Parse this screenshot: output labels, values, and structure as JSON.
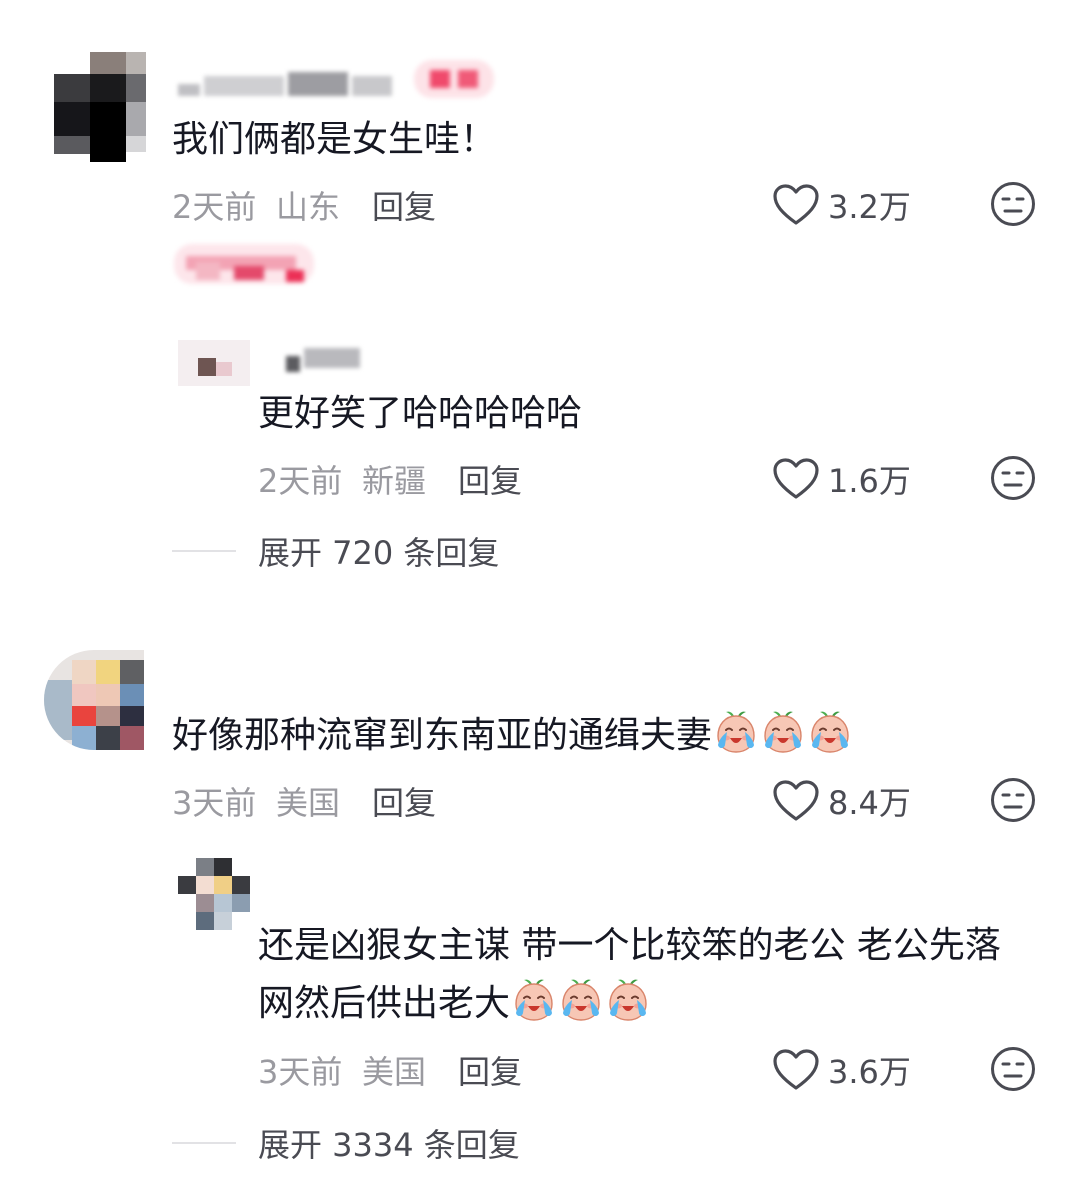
{
  "comments": [
    {
      "text": "我们俩都是女生哇！",
      "time": "2天前",
      "location": "山东",
      "reply_label": "回复",
      "likes": "3.2万"
    },
    {
      "text": "好像那种流窜到东南亚的通缉夫妻",
      "time": "3天前",
      "location": "美国",
      "reply_label": "回复",
      "likes": "8.4万"
    }
  ],
  "replies": [
    {
      "text": "更好笑了哈哈哈哈哈",
      "time": "2天前",
      "location": "新疆",
      "reply_label": "回复",
      "likes": "1.6万",
      "expand": "展开 720 条回复"
    },
    {
      "text_line1": "还是凶狠女主谋 带一个比较笨的老公 老公先落",
      "text_line2": "网然后供出老大",
      "time": "3天前",
      "location": "美国",
      "reply_label": "回复",
      "likes": "3.6万",
      "expand": "展开 3334 条回复"
    }
  ],
  "icons": {
    "like": "heart-outline-icon",
    "dislike": "neutral-face-icon",
    "emoji": "crying-peach-emoji"
  },
  "colors": {
    "text_primary": "#161823",
    "text_secondary": "#9a9aa0",
    "text_action": "#4a4b53",
    "tag_pink": "#fe2c55"
  }
}
